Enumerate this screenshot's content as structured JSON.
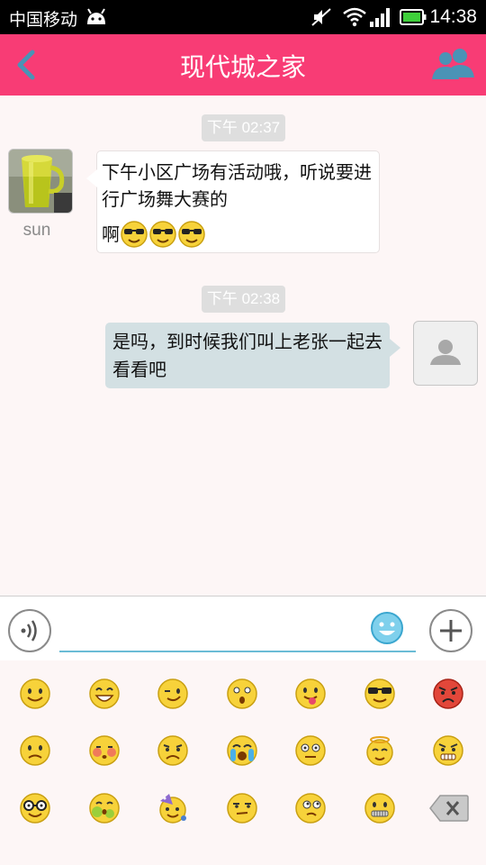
{
  "status_bar": {
    "carrier": "中国移动",
    "time": "14:38"
  },
  "header": {
    "title": "现代城之家"
  },
  "messages": [
    {
      "timestamp": "下午 02:37",
      "sender": "sun",
      "text": "下午小区广场有活动哦，听说要进行广场舞大赛的",
      "tail": "啊",
      "emojis": [
        "sunglasses-emoji",
        "sunglasses-emoji",
        "sunglasses-emoji"
      ]
    },
    {
      "timestamp": "下午 02:38",
      "sender": "me",
      "text": "是吗，到时候我们叫上老张一起去看看吧"
    }
  ],
  "input": {
    "value": "",
    "placeholder": ""
  },
  "emoji_panel": {
    "rows": [
      [
        "smile",
        "grin",
        "wink",
        "surprised",
        "tongue",
        "cool",
        "angry"
      ],
      [
        "worried",
        "blush",
        "frown",
        "crying",
        "dizzy-eyes",
        "halo",
        "grimace"
      ],
      [
        "nerd",
        "sick",
        "party",
        "smirk",
        "thinking",
        "zipper-mouth",
        "delete"
      ]
    ]
  },
  "colors": {
    "header": "#f83c75",
    "chat_bg": "#fdf6f6",
    "out_bubble": "#d3e0e3",
    "input_underline": "#6bbcd6"
  }
}
